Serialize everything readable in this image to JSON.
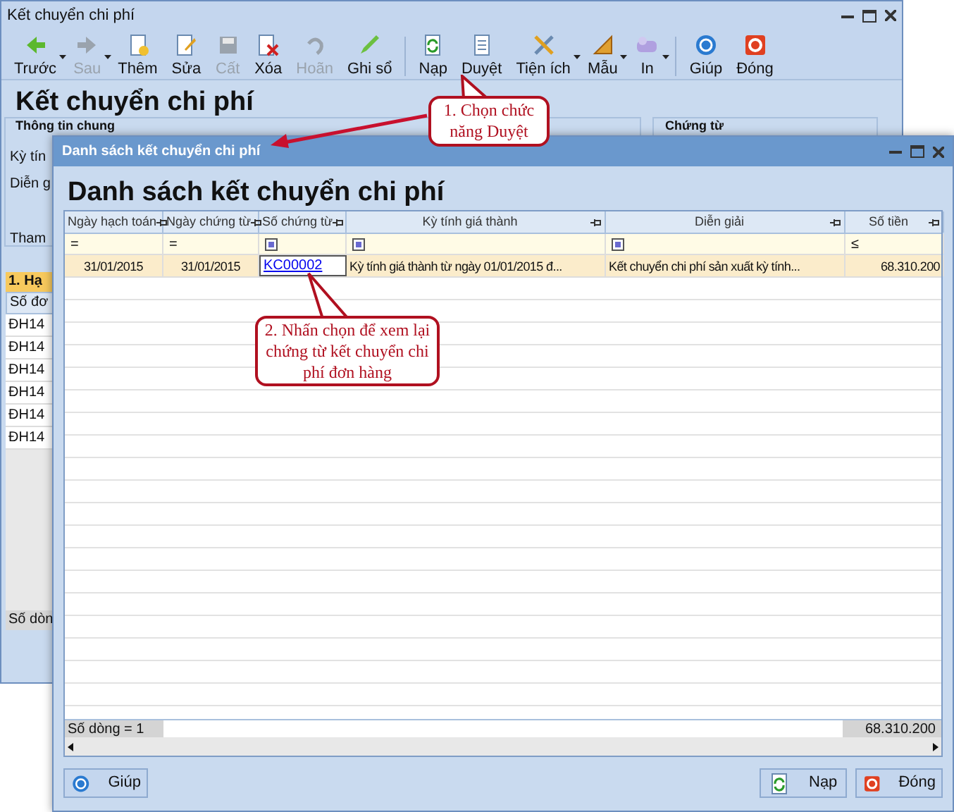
{
  "main_window": {
    "title": "Kết chuyển chi phí",
    "heading": "Kết chuyển chi phí",
    "toolbar": [
      {
        "label": "Trước",
        "disabled": false,
        "dropdown": true
      },
      {
        "label": "Sau",
        "disabled": true,
        "dropdown": true
      },
      {
        "label": "Thêm",
        "disabled": false,
        "dropdown": false
      },
      {
        "label": "Sửa",
        "disabled": false,
        "dropdown": false
      },
      {
        "label": "Cất",
        "disabled": true,
        "dropdown": false
      },
      {
        "label": "Xóa",
        "disabled": false,
        "dropdown": false
      },
      {
        "label": "Hoãn",
        "disabled": true,
        "dropdown": false
      },
      {
        "label": "Ghi sổ",
        "disabled": false,
        "dropdown": false
      },
      {
        "label": "Nạp",
        "disabled": false,
        "dropdown": false
      },
      {
        "label": "Duyệt",
        "disabled": false,
        "dropdown": false
      },
      {
        "label": "Tiện ích",
        "disabled": false,
        "dropdown": true
      },
      {
        "label": "Mẫu",
        "disabled": false,
        "dropdown": true
      },
      {
        "label": "In",
        "disabled": false,
        "dropdown": true
      },
      {
        "label": "Giúp",
        "disabled": false,
        "dropdown": false
      },
      {
        "label": "Đóng",
        "disabled": false,
        "dropdown": false
      }
    ],
    "general_group": "Thông tin chung",
    "voucher_group": "Chứng từ",
    "field_labels": [
      "Kỳ tín",
      "Diễn g",
      "Tham"
    ],
    "detail_tab": "1. Hạ",
    "detail_column": "Số đơ",
    "detail_rows": [
      "ĐH14",
      "ĐH14",
      "ĐH14",
      "ĐH14",
      "ĐH14",
      "ĐH14"
    ],
    "detail_footer": "Số dòn"
  },
  "dialog": {
    "title": "Danh sách kết chuyển chi phí",
    "heading": "Danh sách kết chuyển chi phí",
    "columns": [
      {
        "label": "Ngày hạch toán",
        "filter": "=",
        "kind": "text"
      },
      {
        "label": "Ngày chứng từ",
        "filter": "=",
        "kind": "text"
      },
      {
        "label": "Số chứng từ",
        "kind": "box"
      },
      {
        "label": "Kỳ tính giá thành",
        "kind": "box"
      },
      {
        "label": "Diễn giải",
        "kind": "box"
      },
      {
        "label": "Số tiền",
        "filter": "≤",
        "kind": "text"
      }
    ],
    "rows": [
      [
        "31/01/2015",
        "31/01/2015",
        "KC00002",
        "Kỳ tính giá thành từ ngày 01/01/2015 đ...",
        "Kết chuyển chi phí sản xuất kỳ tính...",
        "68.310.200"
      ]
    ],
    "footer_count": "Số dòng = 1",
    "footer_total": "68.310.200",
    "buttons": [
      "Giúp",
      "Nạp",
      "Đóng"
    ]
  },
  "callouts": [
    "1. Chọn chức năng Duyệt",
    "2. Nhấn chọn để xem lại chứng từ kết chuyển chi phí đơn hàng"
  ]
}
